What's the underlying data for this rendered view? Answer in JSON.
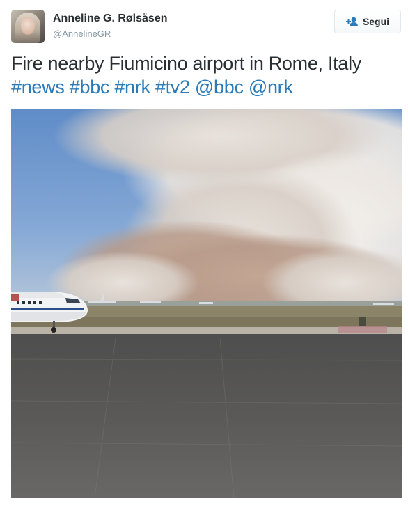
{
  "user": {
    "display_name": "Anneline G. Rølsåsen",
    "screen_name": "@AnnelineGR",
    "avatar_icon": "user-avatar"
  },
  "follow_button": {
    "label": "Segui",
    "icon": "add-user-icon",
    "color": "#2b7bb9"
  },
  "tweet": {
    "text": "Fire nearby Fiumicino airport in Rome, Italy",
    "hashtags": [
      "#news",
      "#bbc",
      "#nrk",
      "#tv2"
    ],
    "mentions": [
      "@bbc",
      "@nrk"
    ],
    "link_color": "#2b7bb9"
  },
  "photo": {
    "subject": "smoke-over-airport-runway-photo"
  }
}
